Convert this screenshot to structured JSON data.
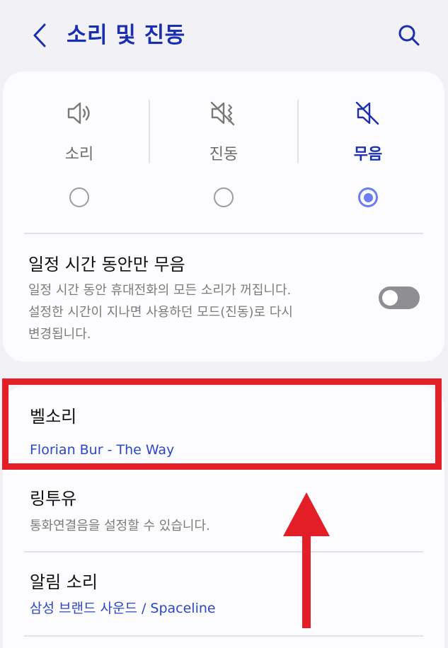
{
  "header": {
    "title": "소리 및 진동",
    "back_icon": "chevron-left-icon",
    "search_icon": "search-icon"
  },
  "modes": [
    {
      "label": "소리",
      "icon": "speaker-icon",
      "selected": false
    },
    {
      "label": "진동",
      "icon": "vibrate-icon",
      "selected": false
    },
    {
      "label": "무음",
      "icon": "mute-icon",
      "selected": true
    }
  ],
  "temporary_mute": {
    "title": "일정 시간 동안만 무음",
    "desc_line1": "일정 시간 동안 휴대전화의 모든 소리가 꺼집니다.",
    "desc_line2": "설정한 시간이 지나면 사용하던 모드(진동)로 다시",
    "desc_line3": "변경됩니다.",
    "enabled": false
  },
  "list": {
    "ringtone": {
      "title": "벨소리",
      "value": "Florian Bur - The Way"
    },
    "ringtoyou": {
      "title": "링투유",
      "desc": "통화연결음을 설정할 수 있습니다."
    },
    "notification_sound": {
      "title": "알림 소리",
      "value": "삼성 브랜드 사운드 / Spaceline"
    }
  },
  "colors": {
    "accent": "#1a2fb0",
    "link": "#2a47c8",
    "radio_selected": "#6a7ff0",
    "annotation_red": "#e31e26",
    "background": "#f2f2f6",
    "card": "#fcfcfe"
  }
}
